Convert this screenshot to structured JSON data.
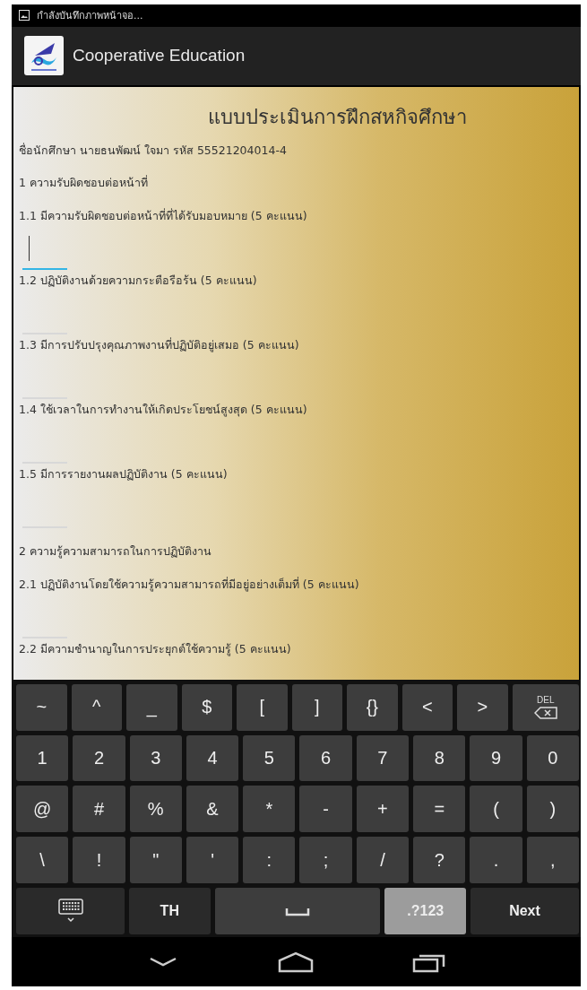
{
  "status_bar": {
    "notification": "กำลังบันทึกภาพหน้าจอ..."
  },
  "action_bar": {
    "title": "Cooperative Education"
  },
  "form": {
    "title": "แบบประเมินการฝึกสหกิจศึกษา",
    "student_line": "ชื่อนักศึกษา นายธนพัฒน์  ใจมา รหัส 55521204014-4",
    "items": [
      {
        "kind": "section",
        "text": "1 ความรับผิดชอบต่อหน้าที่"
      },
      {
        "kind": "question",
        "text": "1.1 มีความรับผิดชอบต่อหน้าที่ที่ได้รับมอบหมาย (5 คะแนน)",
        "focused": true
      },
      {
        "kind": "question",
        "text": "1.2 ปฏิบัติงานด้วยความกระตือรือร้น (5 คะแนน)",
        "focused": false
      },
      {
        "kind": "question",
        "text": "1.3 มีการปรับปรุงคุณภาพงานที่ปฏิบัติอยู่เสมอ (5 คะแนน)",
        "focused": false
      },
      {
        "kind": "question",
        "text": "1.4 ใช้เวลาในการทำงานให้เกิดประโยชน์สูงสุด (5 คะแนน)",
        "focused": false
      },
      {
        "kind": "question",
        "text": "1.5 มีการรายงานผลปฏิบัติงาน (5 คะแนน)",
        "focused": false
      },
      {
        "kind": "section",
        "text": "2 ความรู้ความสามารถในการปฏิบัติงาน"
      },
      {
        "kind": "question",
        "text": "2.1 ปฏิบัติงานโดยใช้ความรู้ความสามารถที่มีอยู่อย่างเต็มที่ (5 คะแนน)",
        "focused": false
      },
      {
        "kind": "question_last",
        "text": "2.2 มีความชำนาญในการประยุกต์ใช้ความรู้ (5 คะแนน)"
      }
    ]
  },
  "keyboard": {
    "rows": [
      [
        {
          "kind": "char",
          "label": "~"
        },
        {
          "kind": "char",
          "label": "^"
        },
        {
          "kind": "char",
          "label": "_"
        },
        {
          "kind": "char",
          "label": "$"
        },
        {
          "kind": "char",
          "label": "["
        },
        {
          "kind": "char",
          "label": "]"
        },
        {
          "kind": "char",
          "label": "{}"
        },
        {
          "kind": "char",
          "label": "<"
        },
        {
          "kind": "char",
          "label": ">"
        },
        {
          "kind": "delete",
          "label": "DEL"
        }
      ],
      [
        {
          "kind": "char",
          "label": "1"
        },
        {
          "kind": "char",
          "label": "2"
        },
        {
          "kind": "char",
          "label": "3"
        },
        {
          "kind": "char",
          "label": "4"
        },
        {
          "kind": "char",
          "label": "5"
        },
        {
          "kind": "char",
          "label": "6"
        },
        {
          "kind": "char",
          "label": "7"
        },
        {
          "kind": "char",
          "label": "8"
        },
        {
          "kind": "char",
          "label": "9"
        },
        {
          "kind": "char",
          "label": "0"
        }
      ],
      [
        {
          "kind": "char",
          "label": "@"
        },
        {
          "kind": "char",
          "label": "#"
        },
        {
          "kind": "char",
          "label": "%"
        },
        {
          "kind": "char",
          "label": "&"
        },
        {
          "kind": "char",
          "label": "*"
        },
        {
          "kind": "char",
          "label": "-"
        },
        {
          "kind": "char",
          "label": "+"
        },
        {
          "kind": "char",
          "label": "="
        },
        {
          "kind": "char",
          "label": "("
        },
        {
          "kind": "char",
          "label": ")"
        }
      ],
      [
        {
          "kind": "char",
          "label": "\\"
        },
        {
          "kind": "char",
          "label": "!"
        },
        {
          "kind": "char",
          "label": "\""
        },
        {
          "kind": "char",
          "label": "'"
        },
        {
          "kind": "char",
          "label": ":"
        },
        {
          "kind": "char",
          "label": ";"
        },
        {
          "kind": "char",
          "label": "/"
        },
        {
          "kind": "char",
          "label": "?"
        },
        {
          "kind": "char",
          "label": "."
        },
        {
          "kind": "char",
          "label": ","
        }
      ]
    ],
    "bottom_row": [
      {
        "kind": "keyboard",
        "selected": false
      },
      {
        "kind": "text",
        "label": "TH",
        "selected": false
      },
      {
        "kind": "space",
        "selected": false
      },
      {
        "kind": "text",
        "label": ".?123",
        "selected": true
      },
      {
        "kind": "text",
        "label": "Next",
        "selected": false
      }
    ]
  }
}
